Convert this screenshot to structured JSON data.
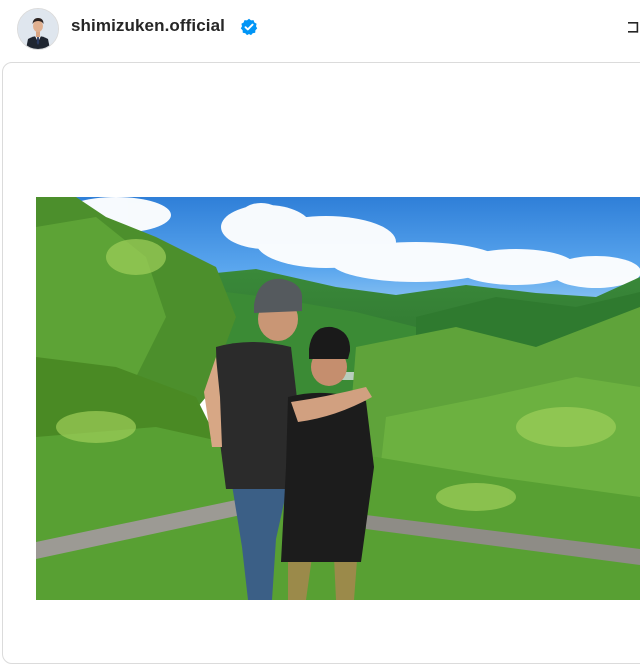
{
  "header": {
    "username": "shimizuken.official",
    "verified": true,
    "avatar_icon": "profile-photo",
    "menu_icon": "more-options-icon"
  },
  "post": {
    "media_type": "photo",
    "description_icon": "landscape-photo"
  },
  "colors": {
    "verified_blue": "#0095f6",
    "text": "#262626",
    "border": "#dbdbdb"
  }
}
